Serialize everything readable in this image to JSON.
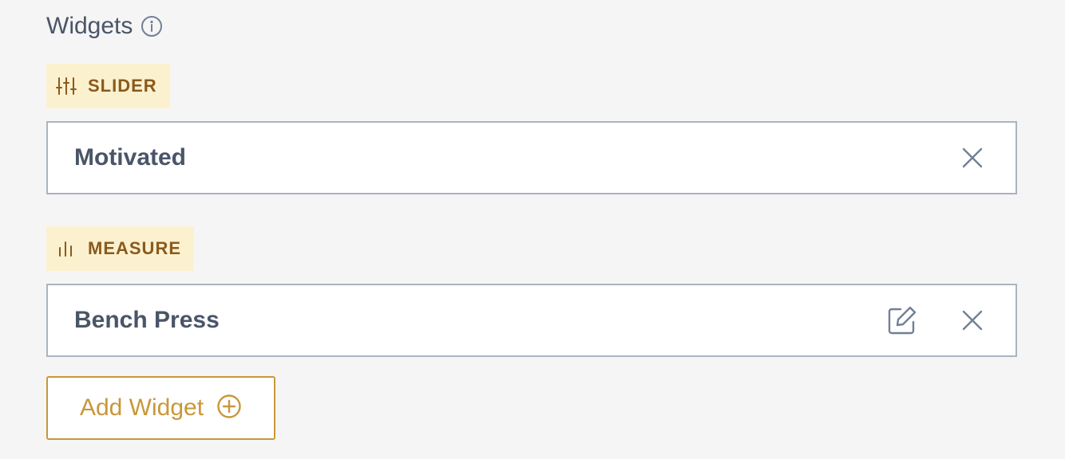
{
  "section": {
    "title": "Widgets",
    "info_icon": "info-circle-icon"
  },
  "widgets": [
    {
      "type_label": "SLIDER",
      "type_icon": "sliders-icon",
      "name": "Motivated",
      "actions": [
        "close-icon"
      ]
    },
    {
      "type_label": "MEASURE",
      "type_icon": "bar-chart-icon",
      "name": "Bench Press",
      "actions": [
        "edit-icon",
        "close-icon"
      ]
    }
  ],
  "add_button": {
    "label": "Add Widget",
    "icon": "plus-circle-icon"
  },
  "colors": {
    "background": "#f5f5f5",
    "tag_background": "#fcf1cf",
    "tag_text": "#8a5a1c",
    "text": "#4a5568",
    "border": "#aab4c2",
    "accent": "#c9973a"
  }
}
